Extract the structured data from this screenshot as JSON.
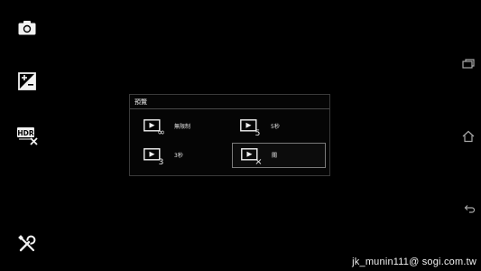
{
  "toolbar": {
    "items": [
      {
        "icon": "camera-icon"
      },
      {
        "icon": "exposure-icon"
      },
      {
        "icon": "hdr-off-icon",
        "text": "HDR"
      },
      {
        "icon": "settings-tools-icon"
      }
    ]
  },
  "nav": {
    "items": [
      {
        "icon": "recent-apps-icon"
      },
      {
        "icon": "home-icon"
      },
      {
        "icon": "back-icon"
      }
    ]
  },
  "dialog": {
    "title": "預覽",
    "options": [
      {
        "label": "無限制",
        "icon": "preview-unlimited-icon",
        "icon_text": "∞",
        "selected": false
      },
      {
        "label": "5秒",
        "icon": "preview-5s-icon",
        "icon_text": "5",
        "selected": false
      },
      {
        "label": "3秒",
        "icon": "preview-3s-icon",
        "icon_text": "3",
        "selected": false
      },
      {
        "label": "關",
        "icon": "preview-off-icon",
        "icon_text": "×",
        "selected": true
      }
    ]
  },
  "watermark": "jk_munin111@ sogi.com.tw",
  "colors": {
    "background": "#000000",
    "dialog_border": "#3a3a3a",
    "selected_border": "#7a7a7a",
    "text": "#e8e8e8"
  }
}
